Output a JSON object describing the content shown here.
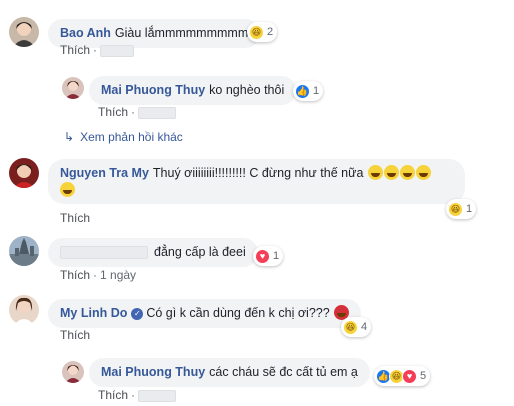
{
  "comments": [
    {
      "author": "Bao Anh",
      "text": "Giàu lắmmmmmmmmm",
      "like_label": "Thích",
      "time": "",
      "reactions": {
        "types": [
          "haha"
        ],
        "count": "2"
      },
      "replies": [
        {
          "author": "Mai Phuong Thuy",
          "text": "ko nghèo thôi",
          "like_label": "Thích",
          "time": "",
          "reactions": {
            "types": [
              "like"
            ],
            "count": "1"
          }
        }
      ],
      "more_replies_label": "Xem phản hồi khác"
    },
    {
      "author": "Nguyen Tra My",
      "text_line1": "Thuý ơiiiiiiii!!!!!!!!! C đừng như thế nữa",
      "like_label": "Thích",
      "reactions": {
        "types": [
          "haha"
        ],
        "count": "1"
      }
    },
    {
      "author": "",
      "text": "đẳng cấp là đeei",
      "like_label": "Thích",
      "time": "1 ngày",
      "reactions": {
        "types": [
          "love"
        ],
        "count": "1"
      }
    },
    {
      "author": "My Linh Do",
      "text": "Có gì k cần dùng đến k chị ơi???",
      "like_label": "Thích",
      "reactions": {
        "types": [
          "haha"
        ],
        "count": "4"
      },
      "replies": [
        {
          "author": "Mai Phuong Thuy",
          "text": "các cháu sẽ đc cất tủ em ạ",
          "like_label": "Thích",
          "reactions": {
            "types": [
              "like",
              "haha",
              "love"
            ],
            "count": "5"
          }
        }
      ]
    }
  ],
  "colors": {
    "link": "#365899",
    "bubble": "#f2f3f5",
    "like": "#1877f2",
    "haha": "#f7d33b",
    "love": "#f33e58"
  }
}
